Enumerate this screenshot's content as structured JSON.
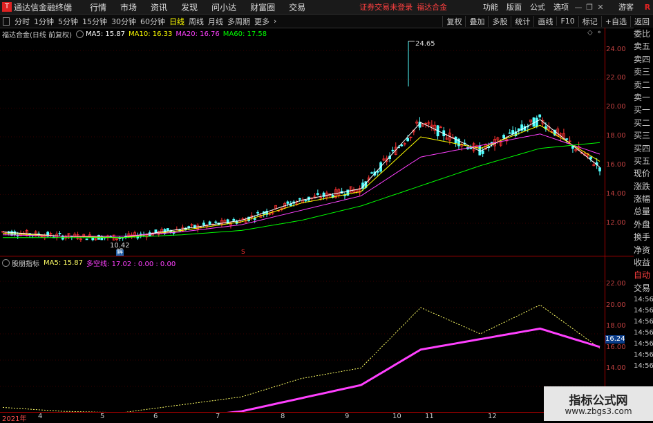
{
  "app": {
    "title": "通达信金融终端",
    "menu": [
      "行情",
      "市场",
      "资讯",
      "发现",
      "问小达",
      "财富圈",
      "交易"
    ],
    "warning": "证券交易未登录",
    "stock_name": "福达合金",
    "right_menu": [
      "功能",
      "版面",
      "公式",
      "选项"
    ],
    "guest": "游客"
  },
  "toolbar": {
    "periods": [
      "分时",
      "1分钟",
      "5分钟",
      "15分钟",
      "30分钟",
      "60分钟",
      "日线",
      "周线",
      "月线",
      "多周期",
      "更多"
    ],
    "active_period": "日线",
    "buttons": [
      "复权",
      "叠加",
      "多股",
      "统计",
      "画线",
      "F10",
      "标记",
      "+自选",
      "返回"
    ]
  },
  "main_legend": {
    "stock": "福达合金(日线 前复权)",
    "ma5": "MA5: 15.87",
    "ma10": "MA10: 16.33",
    "ma20": "MA20: 16.76",
    "ma60": "MA60: 17.58",
    "colors": {
      "ma5": "#ffffff",
      "ma10": "#ffff00",
      "ma20": "#ff40ff",
      "ma60": "#00ff00"
    }
  },
  "sub_legend": {
    "name": "股朋指标",
    "ma5": "MA5: 15.87",
    "duokong": "多空线: 17.02 : 0.00 : 0.00"
  },
  "main_axis": [
    "24.00",
    "22.00",
    "20.00",
    "18.00",
    "16.00",
    "14.00",
    "12.00"
  ],
  "sub_axis": [
    "22.00",
    "20.00",
    "18.00",
    "16.00",
    "14.00"
  ],
  "current_price_tag": "16.24",
  "annotations": {
    "high": "24.65",
    "low": "10.42",
    "jie": "解"
  },
  "dates": [
    "2021年",
    "4",
    "5",
    "6",
    "7",
    "8",
    "9",
    "10",
    "11",
    "12"
  ],
  "side_panel": [
    "委比",
    "卖五",
    "卖四",
    "卖三",
    "卖二",
    "卖一",
    "买一",
    "买二",
    "买三",
    "买四",
    "买五",
    "现价",
    "涨跌",
    "涨幅",
    "总量",
    "外盘",
    "换手",
    "净资",
    "收益",
    "自动",
    "交易"
  ],
  "side_times": [
    "14:56",
    "14:56",
    "14:56",
    "14:56",
    "14:56",
    "14:56",
    "14:56"
  ],
  "watermark": {
    "line1": "指标公式网",
    "line2": "www.zbgs3.com"
  },
  "chart_data": {
    "type": "line",
    "title": "福达合金(日线 前复权)",
    "xlabel": "",
    "ylabel": "",
    "ylim": [
      10,
      25
    ],
    "x": [
      "2021-03",
      "2021-04",
      "2021-05",
      "2021-06",
      "2021-07",
      "2021-08",
      "2021-09",
      "2021-10",
      "2021-11",
      "2021-12",
      "2022-01"
    ],
    "series": [
      {
        "name": "MA5",
        "values": [
          11.4,
          11.1,
          11.0,
          11.6,
          12.2,
          13.6,
          14.4,
          19.0,
          17.0,
          19.2,
          15.9
        ]
      },
      {
        "name": "MA10",
        "values": [
          11.3,
          11.1,
          11.0,
          11.5,
          12.1,
          13.4,
          14.2,
          18.0,
          17.2,
          18.8,
          16.3
        ]
      },
      {
        "name": "MA20",
        "values": [
          11.2,
          11.1,
          11.1,
          11.4,
          11.9,
          12.9,
          13.9,
          16.6,
          17.4,
          18.2,
          16.8
        ]
      },
      {
        "name": "MA60",
        "values": [
          11.0,
          11.0,
          11.0,
          11.2,
          11.5,
          12.2,
          13.2,
          14.6,
          16.0,
          17.2,
          17.6
        ]
      }
    ]
  }
}
